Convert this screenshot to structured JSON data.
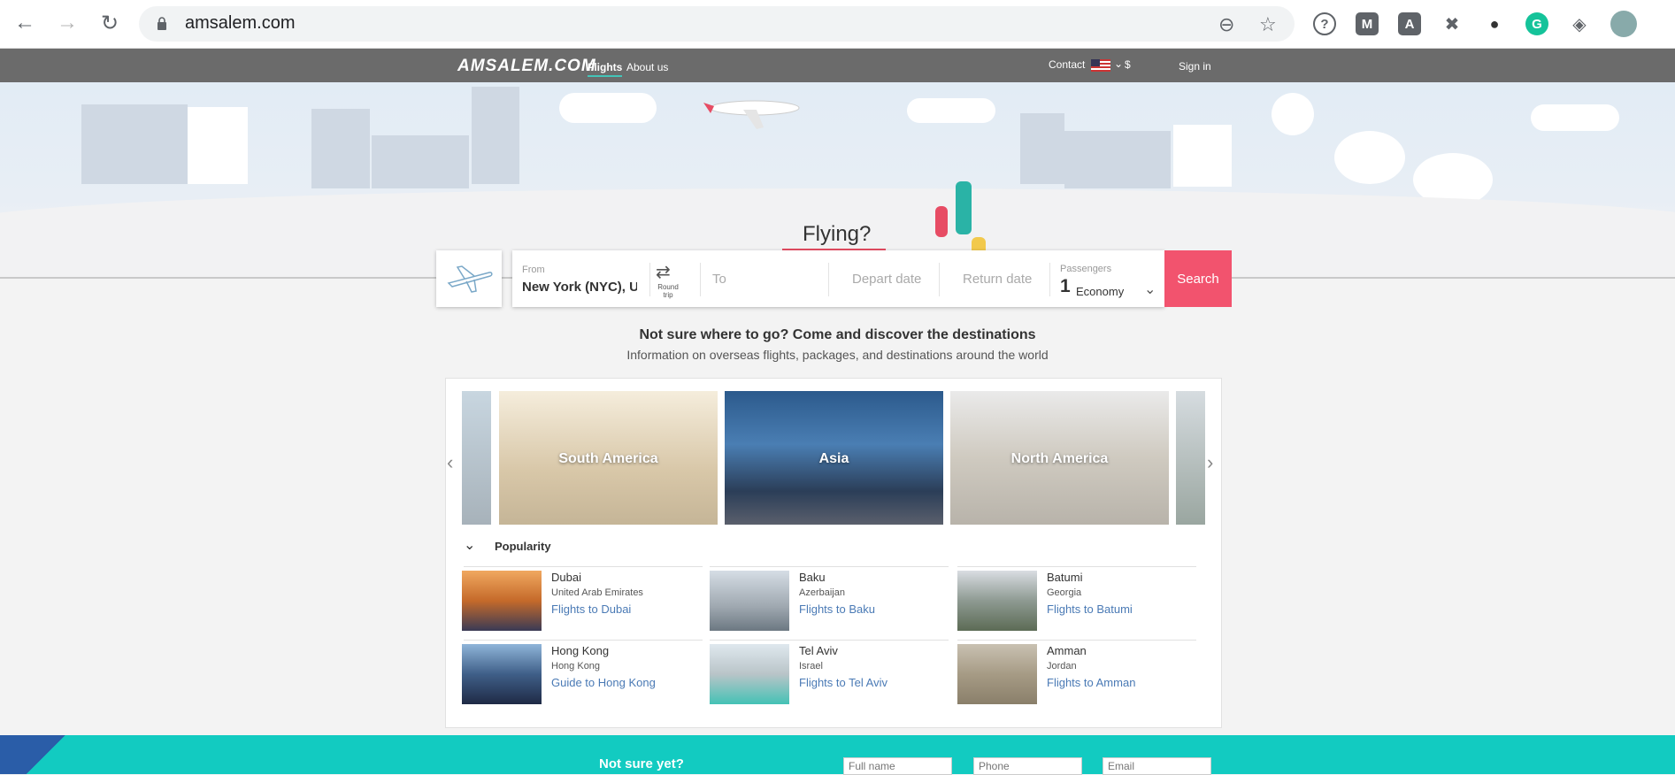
{
  "browser": {
    "url": "amsalem.com"
  },
  "header": {
    "logo": "AMSALEM.COM",
    "nav": [
      "Flights",
      "About us"
    ],
    "contact": "Contact",
    "currency": "$",
    "sign_in": "Sign in"
  },
  "hero": {
    "title": "Flying?"
  },
  "search": {
    "from_label": "From",
    "from_value": "New York (NYC), Ui",
    "trip_type": "Round trip",
    "to_placeholder": "To",
    "depart_placeholder": "Depart date",
    "return_placeholder": "Return date",
    "passengers_label": "Passengers",
    "passengers_count": "1",
    "cabin_class": "Economy",
    "search_button": "Search"
  },
  "destinations": {
    "heading": "Not sure where to go? Come and discover the destinations",
    "subheading": "Information on overseas flights, packages, and destinations around the world",
    "regions": [
      "South America",
      "Asia",
      "North America"
    ],
    "sort_label": "Popularity",
    "items": [
      {
        "city": "Dubai",
        "country": "United Arab Emirates",
        "link": "Flights to Dubai"
      },
      {
        "city": "Baku",
        "country": "Azerbaijan",
        "link": "Flights to Baku"
      },
      {
        "city": "Batumi",
        "country": "Georgia",
        "link": "Flights to Batumi"
      },
      {
        "city": "Hong Kong",
        "country": "Hong Kong",
        "link": "Guide to Hong Kong"
      },
      {
        "city": "Tel Aviv",
        "country": "Israel",
        "link": "Flights to Tel Aviv"
      },
      {
        "city": "Amman",
        "country": "Jordan",
        "link": "Flights to Amman"
      }
    ]
  },
  "footer": {
    "title": "Not sure yet?",
    "full_name_placeholder": "Full name",
    "phone_placeholder": "Phone",
    "email_placeholder": "Email"
  },
  "colors": {
    "accent": "#f2536e",
    "teal": "#12cbc1",
    "header_bg": "#6b6b6b",
    "link": "#4a7ab5"
  }
}
